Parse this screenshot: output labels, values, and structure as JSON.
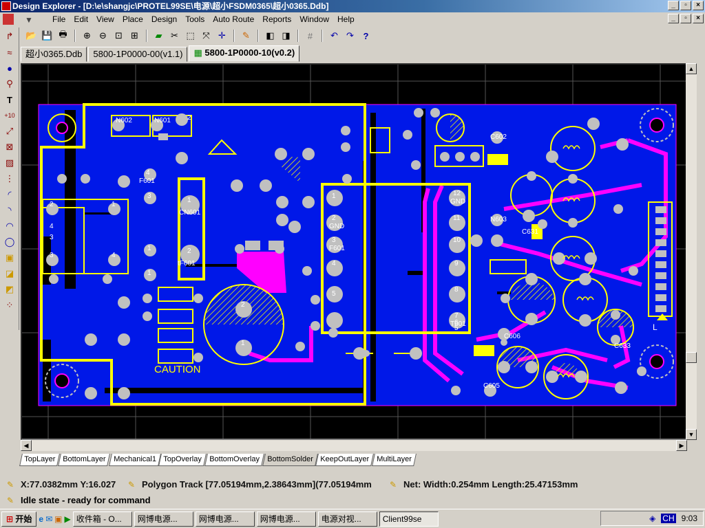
{
  "window": {
    "title": "Design Explorer - [D:\\e\\shangjc\\PROTEL99SE\\电源\\超小FSDM0365\\超小0365.Ddb]"
  },
  "menu": {
    "items": [
      "File",
      "Edit",
      "View",
      "Place",
      "Design",
      "Tools",
      "Auto Route",
      "Reports",
      "Window",
      "Help"
    ]
  },
  "toolbar": {
    "icons": [
      "open-icon",
      "save-icon",
      "print-icon",
      "zoom-in-icon",
      "zoom-out-icon",
      "zoom-fit-icon",
      "zoom-area-icon",
      "browse-icon",
      "cut-icon",
      "select-icon",
      "deselect-icon",
      "move-icon",
      "wizard-icon",
      "library-icon",
      "library-browse-icon",
      "grid-icon",
      "undo-icon",
      "redo-icon",
      "help-icon"
    ]
  },
  "doc_tabs": [
    "超小0365.Ddb",
    "5800-1P0000-00(v1.1)",
    "5800-1P0000-10(v0.2)"
  ],
  "board": {
    "caution": "CAUTION",
    "colors": {
      "bottom": "#0018e8",
      "top": "#ff00ff",
      "overlay": "#ffff00",
      "pad": "#c0c0c0",
      "outline": "#ff00ff"
    },
    "labels": [
      "N602",
      "N601",
      "2",
      "1",
      "4",
      "F601",
      "3",
      "1",
      "1",
      "2",
      "3",
      "4",
      "2",
      "2",
      "2",
      "CN601",
      "2",
      "tF601",
      "1",
      "3",
      "4",
      "1",
      "2",
      "GND",
      "1",
      "1",
      "2",
      "GND",
      "3",
      "F601",
      "4",
      "5",
      "12",
      "GND",
      "11",
      "10",
      "9",
      "8",
      "7",
      "6",
      "5",
      "T601",
      "C602",
      "N603",
      "C631",
      "C633",
      "C606",
      "C605",
      "4",
      "3",
      "L"
    ]
  },
  "layers": [
    "TopLayer",
    "BottomLayer",
    "Mechanical1",
    "TopOverlay",
    "BottomOverlay",
    "BottomSolder",
    "KeepOutLayer",
    "MultiLayer"
  ],
  "status": {
    "coords": "X:77.0382mm Y:16.027",
    "track": "Polygon Track [77.05194mm,2.38643mm](77.05194mm",
    "net": "Net: Width:0.254mm Length:25.47153mm",
    "state": "Idle state - ready for command"
  },
  "taskbar": {
    "start": "开始",
    "tasks": [
      "收件箱 - O...",
      "网博电源...",
      "网博电源...",
      "网博电源...",
      "电源对视...",
      "Client99se"
    ],
    "clock": "9:03",
    "lang": "CH"
  }
}
